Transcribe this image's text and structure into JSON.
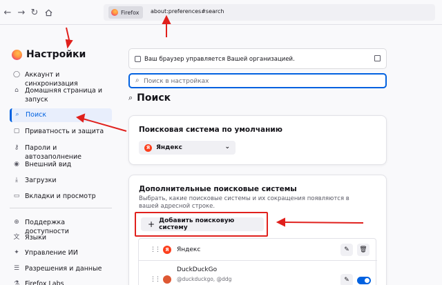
{
  "toolbar": {
    "back_icon": "arrow-left-icon",
    "forward_icon": "arrow-right-icon",
    "reload_icon": "reload-icon",
    "home_icon": "home-icon",
    "identity_label": "Firefox",
    "url": "about:preferences#search"
  },
  "sidebar": {
    "title": "Настройки",
    "items": [
      {
        "label": "Аккаунт и синхронизация",
        "icon": "account-icon"
      },
      {
        "label": "Домашняя страница и запуск",
        "icon": "home-icon"
      },
      {
        "label": "Поиск",
        "icon": "search-icon",
        "active": true
      },
      {
        "label": "Приватность и защита",
        "icon": "lock-icon"
      },
      {
        "label": "Пароли и автозаполнение",
        "icon": "key-icon"
      },
      {
        "label": "Внешний вид",
        "icon": "eye-icon"
      },
      {
        "label": "Загрузки",
        "icon": "download-icon"
      },
      {
        "label": "Вкладки и просмотр",
        "icon": "tabs-icon"
      },
      {
        "label": "Поддержка доступности",
        "icon": "accessibility-icon"
      },
      {
        "label": "Языки",
        "icon": "language-icon"
      },
      {
        "label": "Управление ИИ",
        "icon": "ai-icon"
      },
      {
        "label": "Разрешения и данные",
        "icon": "permissions-icon"
      },
      {
        "label": "Firefox Labs",
        "icon": "labs-icon"
      }
    ]
  },
  "main": {
    "org_notice": "Ваш браузер управляется Вашей организацией.",
    "search_placeholder": "Поиск в настройках",
    "page_title": "Поиск",
    "default_engine": {
      "heading": "Поисковая система по умолчанию",
      "selected": "Яндекс"
    },
    "additional": {
      "heading": "Дополнительные поисковые системы",
      "description": "Выбрать, какие поисковые системы и их сокращения появляются в вашей адресной строке.",
      "add_button": "Добавить поисковую систему",
      "engines": [
        {
          "name": "Яндекс",
          "alias": ""
        },
        {
          "name": "DuckDuckGo",
          "alias": "@duckduckgo, @ddg"
        }
      ]
    }
  },
  "colors": {
    "accent": "#0061e0",
    "annotation": "#e0201c",
    "yandex": "#fc3f1d",
    "duckduckgo": "#de5833"
  }
}
